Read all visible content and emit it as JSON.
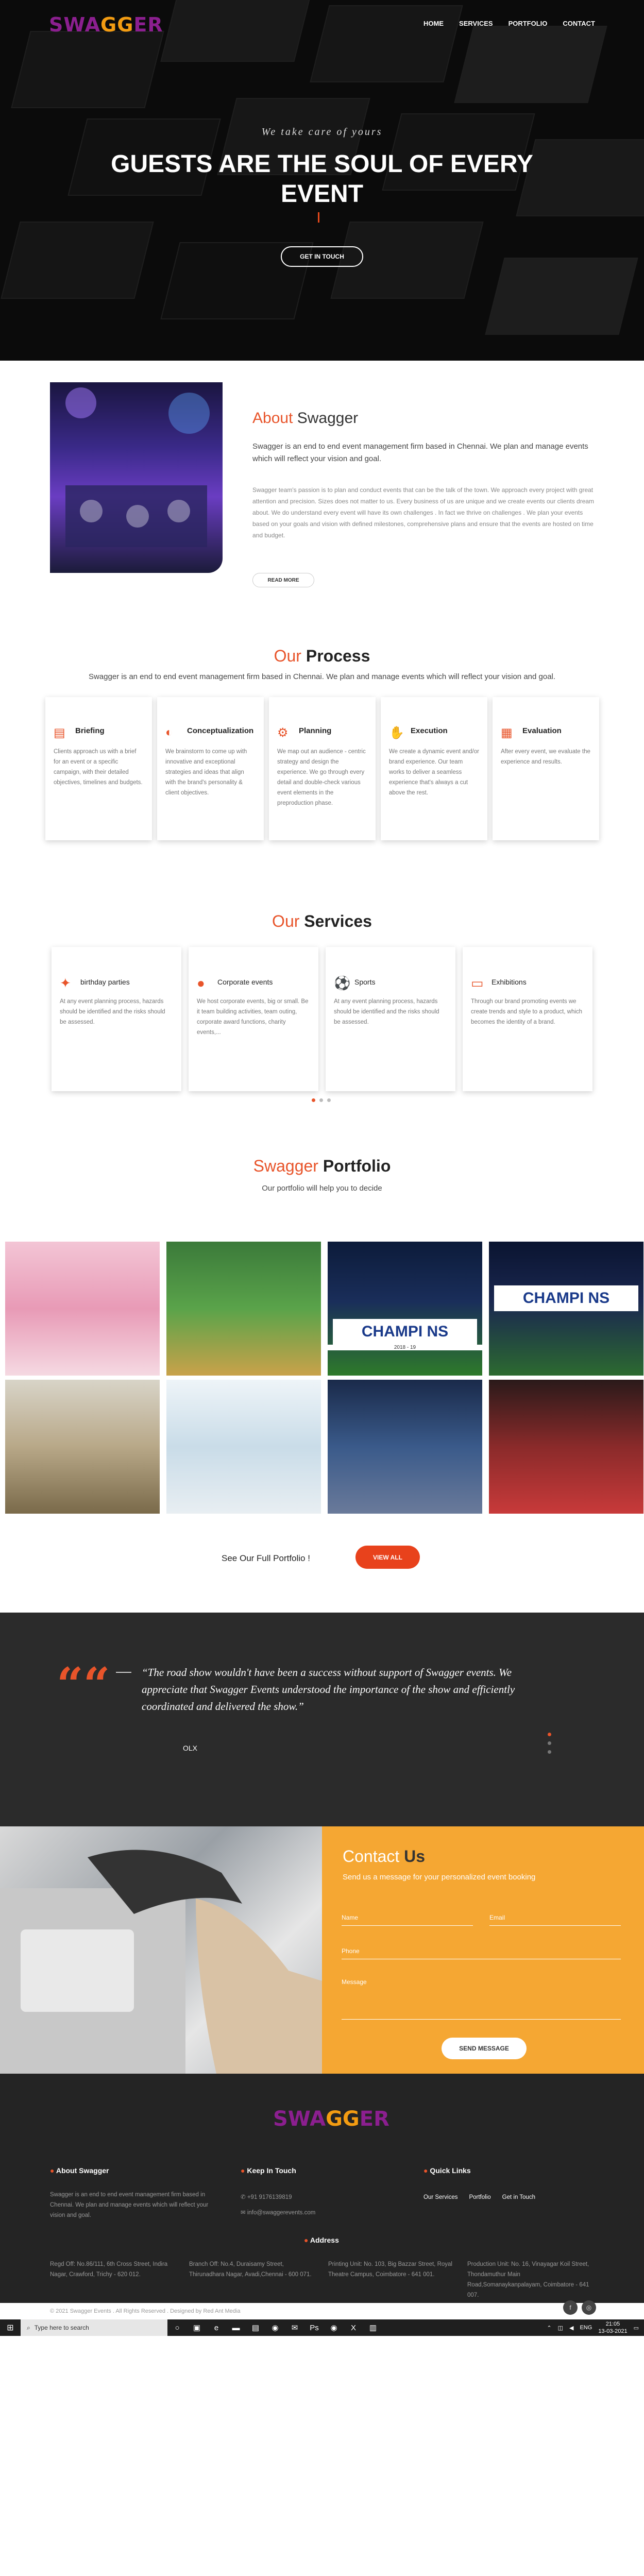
{
  "brand": {
    "logo_text_a": "SWA",
    "logo_text_b": "GG",
    "logo_text_c": "ER"
  },
  "nav": {
    "items": [
      "HOME",
      "SERVICES",
      "PORTFOLIO",
      "CONTACT"
    ]
  },
  "hero": {
    "tagline": "We take care of yours",
    "title": "GUESTS ARE THE SOUL OF EVERY EVENT",
    "cta": "GET IN TOUCH"
  },
  "about": {
    "title_a": "About",
    "title_b": " Swagger",
    "lead": "Swagger is an end to end event management firm based in Chennai. We plan and manage events which will reflect your vision and goal.",
    "body": "Swagger team's passion is to plan and conduct events that can be the talk of the town. We approach every project with great attention and precision. Sizes does not matter to us. Every business of us are unique and we create events our clients dream about. We do understand every event will have its own challenges . In fact we thrive on challenges . We plan your events based on your goals and vision with defined milestones, comprehensive plans and ensure that the events are hosted on time and budget.",
    "button": "READ MORE"
  },
  "process": {
    "title_a": "Our",
    "title_b": " Process",
    "subtitle": "Swagger is an end to end event management firm based in Chennai. We plan and manage events which will reflect your vision and goal.",
    "cards": [
      {
        "title": "Briefing",
        "icon": "clipboard-icon",
        "text": "Clients approach us with a brief for an event or a specific campaign, with their detailed objectives, timelines and budgets."
      },
      {
        "title": "Conceptualization",
        "icon": "bulb-head-icon",
        "text": "We brainstorm to come up with innovative and exceptional strategies and ideas that align with the brand's personality & client objectives."
      },
      {
        "title": "Planning",
        "icon": "network-icon",
        "text": "We map out an audience - centric strategy and design the experience. We go through every detail and double-check various event elements in the preproduction phase."
      },
      {
        "title": "Execution",
        "icon": "handshake-icon",
        "text": "We create a dynamic event and/or brand experience. Our team works to deliver a seamless experience that's always a cut above the rest."
      },
      {
        "title": "Evaluation",
        "icon": "chart-icon",
        "text": "After every event, we evaluate the experience and results."
      }
    ]
  },
  "services": {
    "title_a": "Our",
    "title_b": " Services",
    "cards": [
      {
        "title": "birthday parties",
        "icon": "party-icon",
        "text": "At any event planning process, hazards should be identified and the risks should be assessed."
      },
      {
        "title": "Corporate events",
        "icon": "people-icon",
        "text": "We host corporate events, big or small. Be it team building activities, team outing, corporate award functions, charity events,..."
      },
      {
        "title": "Sports",
        "icon": "ball-icon",
        "text": "At any event planning process, hazards should be identified and the risks should be assessed."
      },
      {
        "title": "Exhibitions",
        "icon": "board-icon",
        "text": "Through our brand promoting events we create trends and style to a product, which becomes the identity of a brand."
      }
    ]
  },
  "portfolio": {
    "title_a": "Swagger",
    "title_b": " Portfolio",
    "subtitle": "Our portfolio will help you to decide",
    "banner_text_1": "CHAMPI   NS",
    "banner_text_2": "CHAMPI   NS",
    "banner_year": "2018 - 19",
    "full_text": "See Our Full Portfolio !",
    "view_all": "VIEW ALL"
  },
  "testimonial": {
    "quote_mark": "““",
    "text": "“The road show wouldn't have been a success without support of Swagger events. We appreciate that Swagger Events understood the importance of the show and efficiently coordinated and delivered the show.”",
    "author": "OLX"
  },
  "contact": {
    "title_a": "Contact",
    "title_b": " Us",
    "subtitle": "Send us a message for your personalized event booking",
    "name": "Name",
    "email": "Email",
    "phone": "Phone",
    "message": "Message",
    "button": "SEND MESSAGE"
  },
  "footer": {
    "about_title": "About Swagger",
    "about_text": "Swagger is an end to end event management firm based in Chennai. We plan and manage events which will reflect your vision and goal.",
    "keep_title": "Keep In Touch",
    "phone": "+91 9176139819",
    "email": "info@swaggerevents.com",
    "links_title": "Quick Links",
    "links": [
      "Our Services",
      "Portfolio",
      "Get in Touch"
    ],
    "address_title": "Address",
    "addresses": [
      "Regd Off: No.86/111, 6th Cross Street, Indira Nagar, Crawford, Trichy - 620 012.",
      "Branch Off: No.4, Duraisamy Street, Thirunadhara Nagar, Avadi,Chennai - 600 071.",
      "Printing Unit: No. 103, Big Bazzar Street, Royal Theatre Campus, Coimbatore - 641 001.",
      "Production Unit: No. 16, Vinayagar Koil Street, Thondamuthur Main Road,Somanaykanpalayam, Coimbatore - 641 007."
    ],
    "copyright": "© 2021 Swagger Events . All Rights Reserved . Designed by Red Ant Media"
  },
  "taskbar": {
    "search_placeholder": "Type here to search",
    "lang": "ENG",
    "time": "21:05",
    "date": "13-03-2021"
  },
  "colors": {
    "accent": "#e8542a",
    "orange": "#f5a733",
    "dark": "#242424",
    "brand_purple": "#8b1f8f"
  }
}
